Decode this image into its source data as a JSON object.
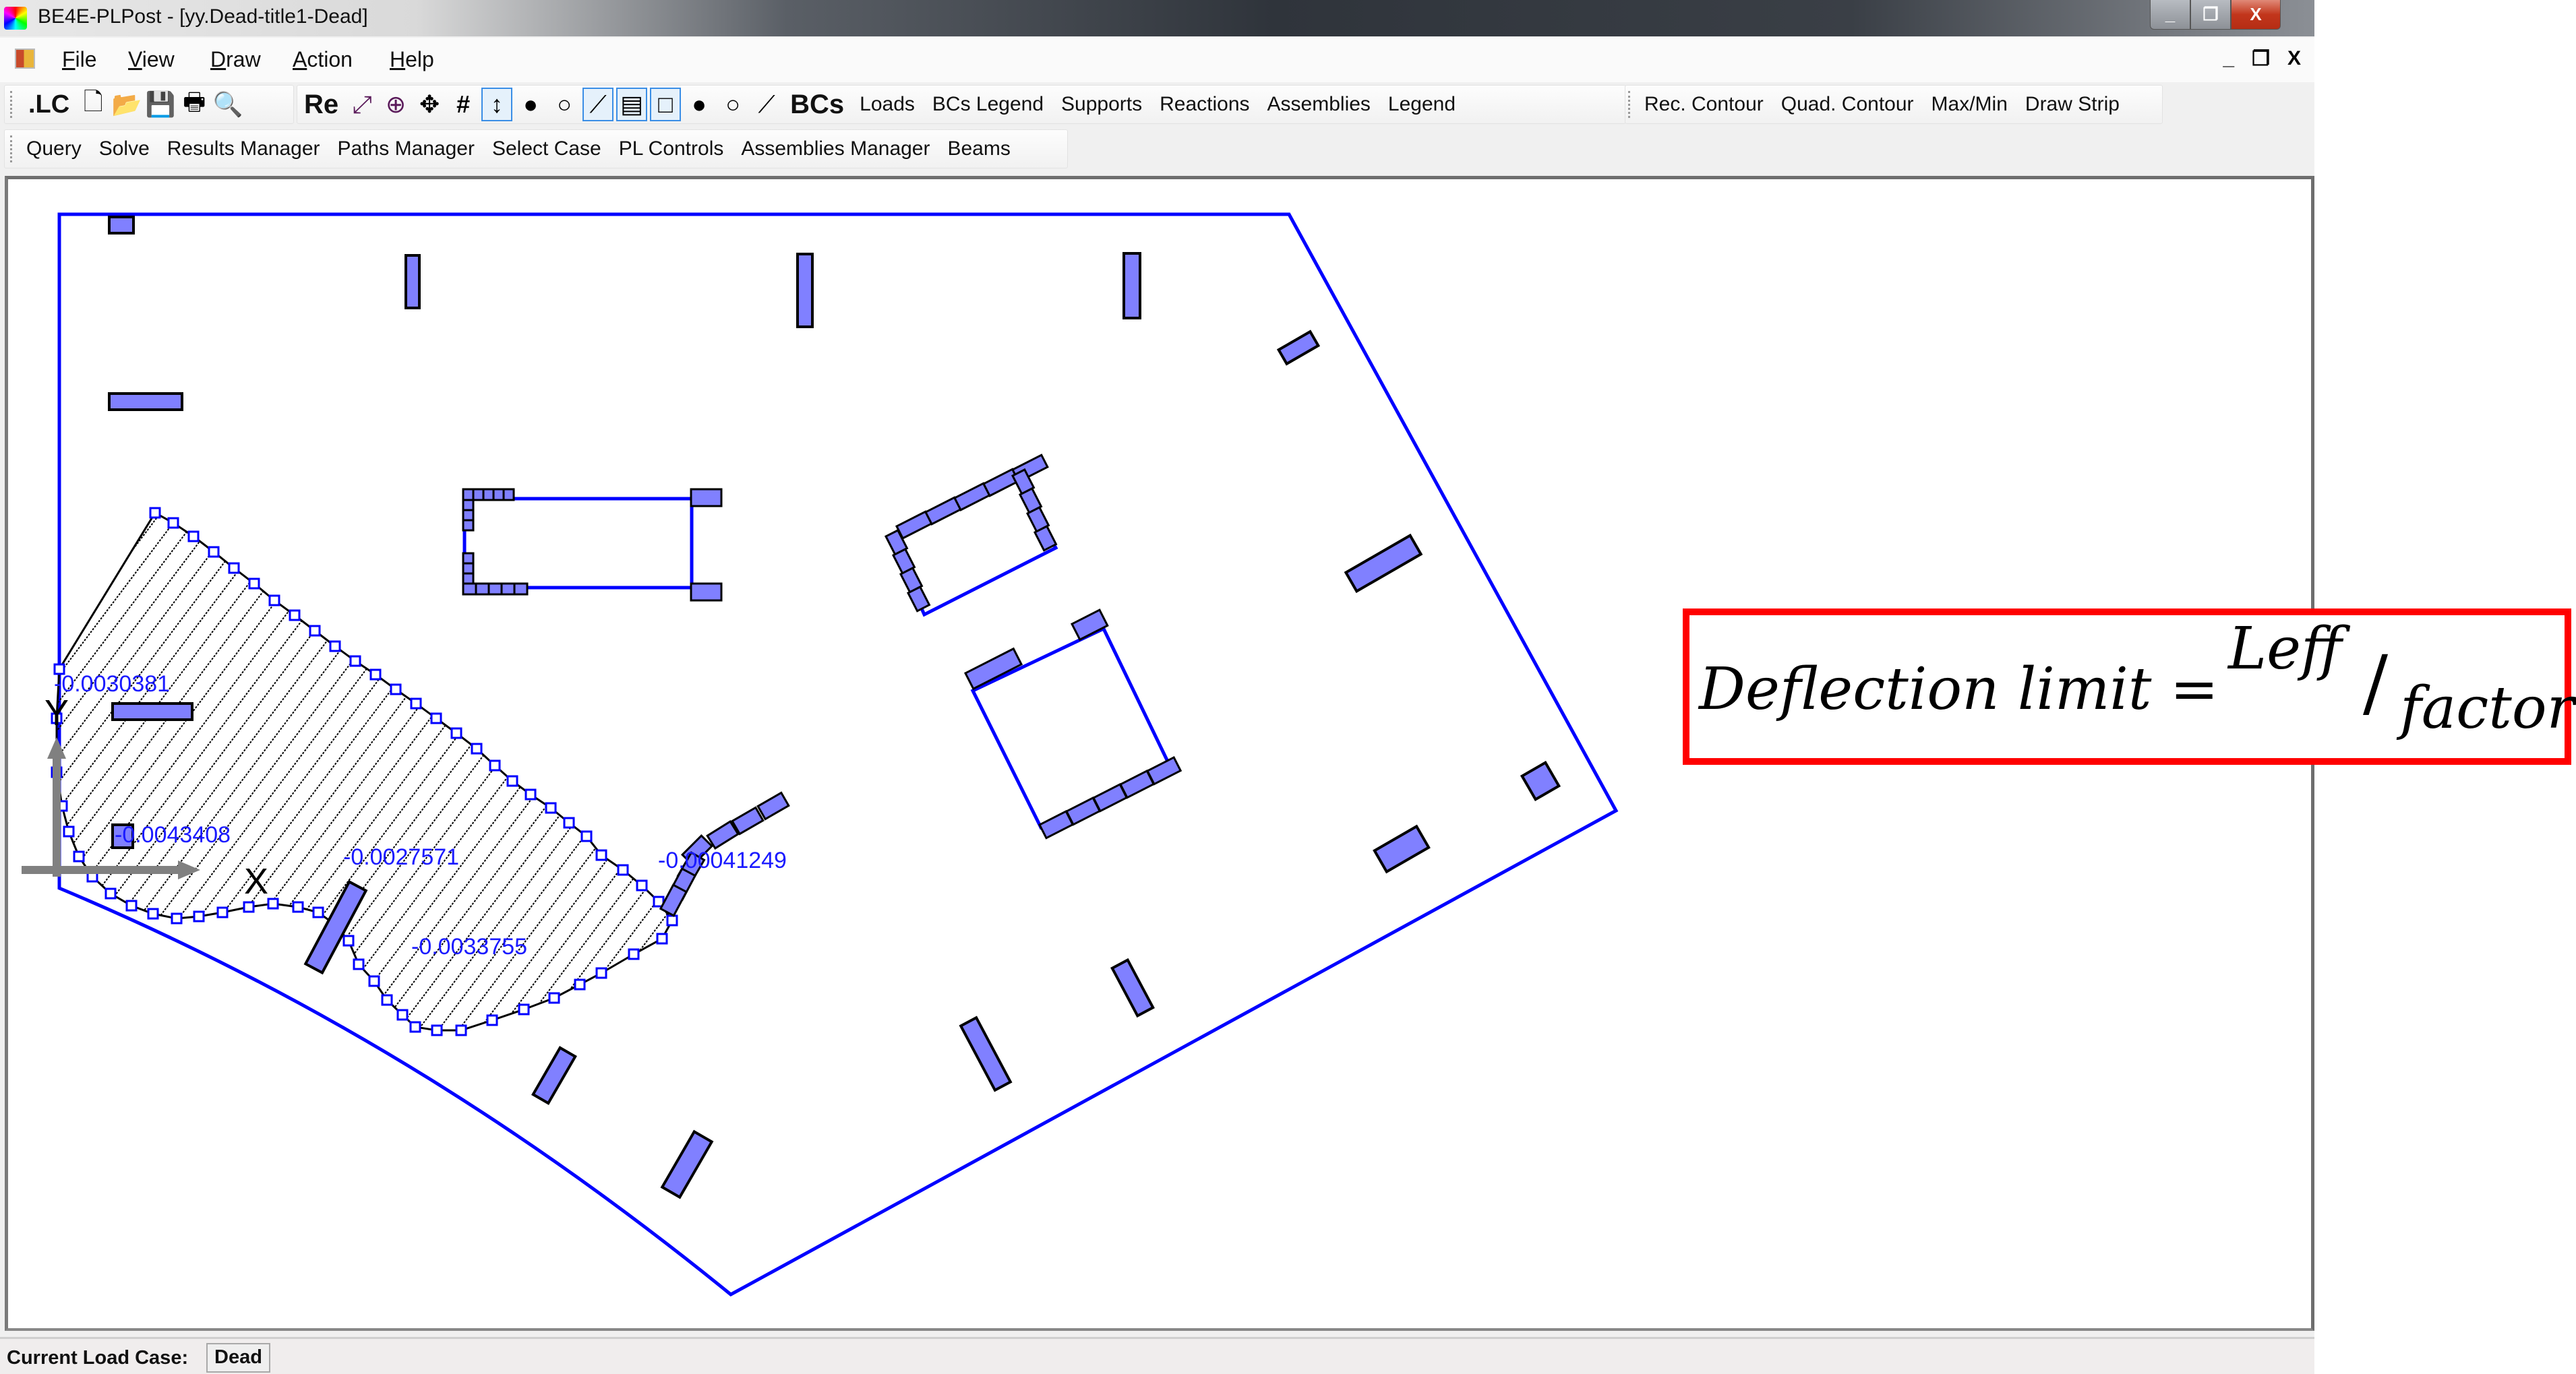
{
  "window": {
    "title": "BE4E-PLPost - [yy.Dead-title1-Dead]",
    "controls": {
      "minimize": "_",
      "restore": "❐",
      "close": "X"
    }
  },
  "menubar": {
    "items": [
      {
        "label": "File",
        "accel": "F"
      },
      {
        "label": "View",
        "accel": "V"
      },
      {
        "label": "Draw",
        "accel": "D"
      },
      {
        "label": "Action",
        "accel": "A"
      },
      {
        "label": "Help",
        "accel": "H"
      }
    ],
    "mdi_controls": {
      "minimize": "_",
      "restore": "❐",
      "close": "X"
    }
  },
  "toolbar1": {
    "file_group": [
      {
        "name": "load-case-button",
        "label": ".LC"
      },
      {
        "name": "new-icon",
        "glyph": "🗋"
      },
      {
        "name": "open-folder-icon",
        "glyph": "📂"
      },
      {
        "name": "save-icon",
        "glyph": "💾"
      },
      {
        "name": "print-icon",
        "glyph": "🖶"
      },
      {
        "name": "print-preview-icon",
        "glyph": "🔍"
      }
    ],
    "view_group": [
      {
        "name": "redraw-button",
        "label": "Re"
      },
      {
        "name": "zoom-extents-icon",
        "glyph": "⤢"
      },
      {
        "name": "zoom-window-icon",
        "glyph": "⊕"
      },
      {
        "name": "pan-icon",
        "glyph": "✥"
      },
      {
        "name": "grid-icon",
        "glyph": "#"
      },
      {
        "name": "axis-icon",
        "glyph": "↕",
        "active": true
      },
      {
        "name": "filled-node-icon",
        "glyph": "●"
      },
      {
        "name": "hollow-node-icon",
        "glyph": "○"
      },
      {
        "name": "beam-select-icon",
        "glyph": "⟋",
        "active": true
      },
      {
        "name": "slab-hatch-icon",
        "glyph": "▤",
        "active": true
      },
      {
        "name": "slab-outline-icon",
        "glyph": "□",
        "active": true
      },
      {
        "name": "filled-node-number-icon",
        "glyph": "●"
      },
      {
        "name": "hollow-node-number-icon",
        "glyph": "○"
      },
      {
        "name": "beam-number-icon",
        "glyph": "⟋"
      }
    ],
    "text_buttons": [
      "BCs",
      "Loads",
      "BCs Legend",
      "Supports",
      "Reactions",
      "Assemblies",
      "Legend"
    ],
    "contour_buttons": [
      "Rec. Contour",
      "Quad. Contour",
      "Max/Min",
      "Draw Strip"
    ]
  },
  "toolbar2": {
    "buttons": [
      "Query",
      "Solve",
      "Results Manager",
      "Paths Manager",
      "Select Case",
      "PL Controls",
      "Assemblies Manager",
      "Beams"
    ]
  },
  "drawing": {
    "axis_labels": {
      "x": "X",
      "y": "Y"
    },
    "deflection_labels": [
      {
        "id": "d1",
        "text": "-0.0030381"
      },
      {
        "id": "d2",
        "text": "-0.0043408"
      },
      {
        "id": "d3",
        "text": "-0.0027571"
      },
      {
        "id": "d4",
        "text": "-0.0033755"
      },
      {
        "id": "d5",
        "text": "-0.00041249"
      }
    ],
    "colors": {
      "slab_outline": "#0000ff",
      "column_fill": "#8080ff",
      "column_stroke": "#000000",
      "label_text": "#1a1aff",
      "axis_arrow": "#808080",
      "hatch": "#000000"
    }
  },
  "annotation": {
    "lhs": "Deflection limit =",
    "numerator": "Leff",
    "slash": "/",
    "denominator": "factor",
    "border_color": "#ff0000"
  },
  "status": {
    "label": "Current Load Case:",
    "value": "Dead"
  }
}
